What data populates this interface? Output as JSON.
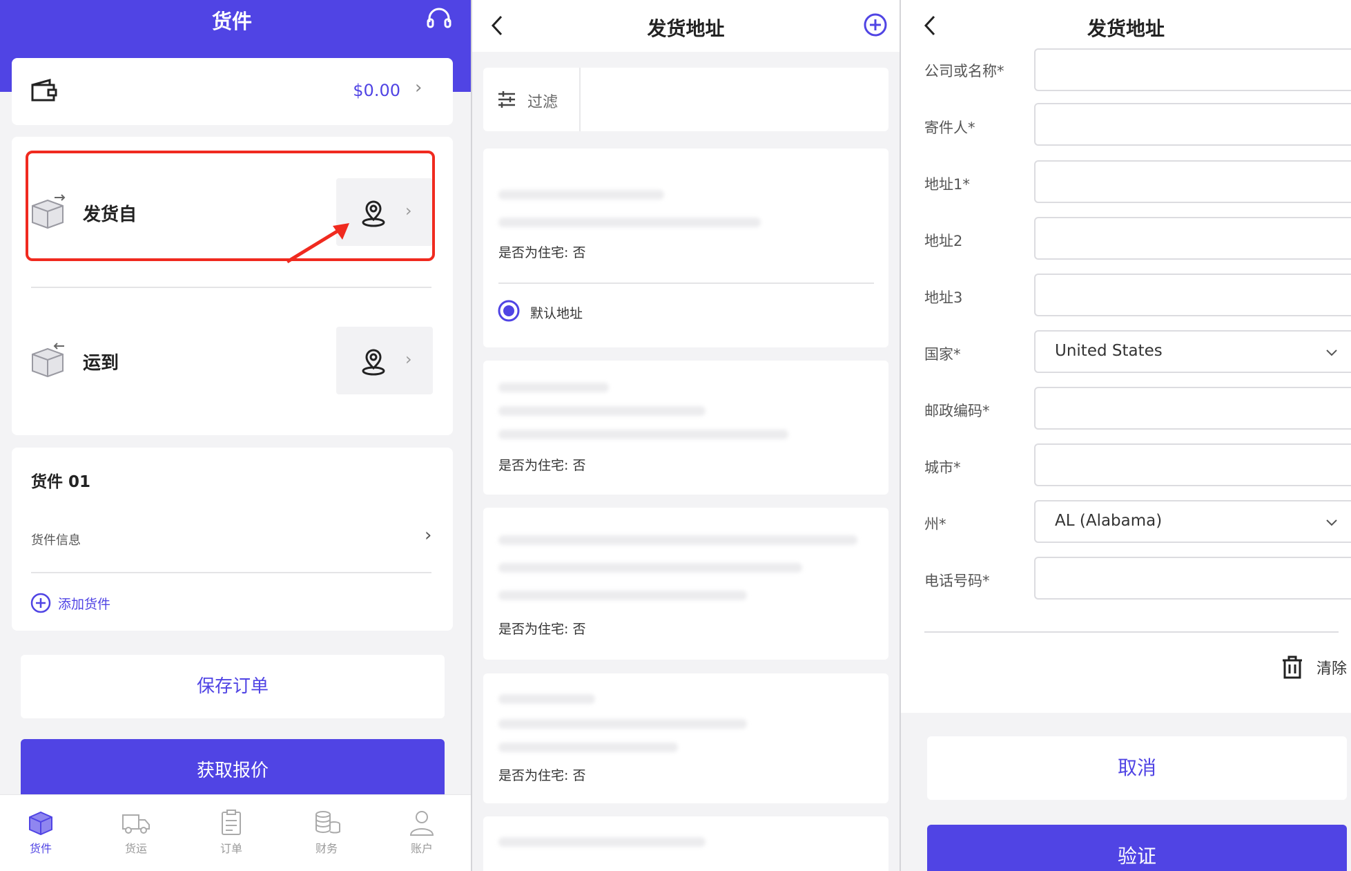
{
  "shipments": {
    "title": "货件",
    "balance": "$0.00",
    "ship_from_label": "发货自",
    "ship_to_label": "运到",
    "cargo_title": "货件 01",
    "cargo_info_label": "货件信息",
    "add_cargo_label": "添加货件",
    "save_order_label": "保存订单",
    "get_quote_label": "获取报价",
    "tabs": [
      {
        "label": "货件",
        "icon": "box-icon",
        "active": true
      },
      {
        "label": "货运",
        "icon": "truck-icon",
        "active": false
      },
      {
        "label": "订单",
        "icon": "clipboard-icon",
        "active": false
      },
      {
        "label": "财务",
        "icon": "coins-icon",
        "active": false
      },
      {
        "label": "账户",
        "icon": "user-icon",
        "active": false
      }
    ]
  },
  "address_list": {
    "title": "发货地址",
    "filter_label": "过滤",
    "cards": [
      {
        "residential": "是否为住宅: 否",
        "default_label": "默认地址"
      },
      {
        "residential": "是否为住宅: 否"
      },
      {
        "residential": "是否为住宅: 否"
      },
      {
        "residential": "是否为住宅: 否"
      }
    ]
  },
  "address_form": {
    "title": "发货地址",
    "fields": {
      "company": "公司或名称*",
      "sender": "寄件人*",
      "address1": "地址1*",
      "address2": "地址2",
      "address3": "地址3",
      "country": "国家*",
      "postal_code": "邮政编码*",
      "city": "城市*",
      "state": "州*",
      "phone": "电话号码*"
    },
    "country_value": "United States",
    "state_value": "AL (Alabama)",
    "clear_label": "清除",
    "cancel_label": "取消",
    "verify_label": "验证"
  },
  "colors": {
    "accent": "#5044e4",
    "highlight": "#f02a1f",
    "background": "#f3f3f5"
  }
}
